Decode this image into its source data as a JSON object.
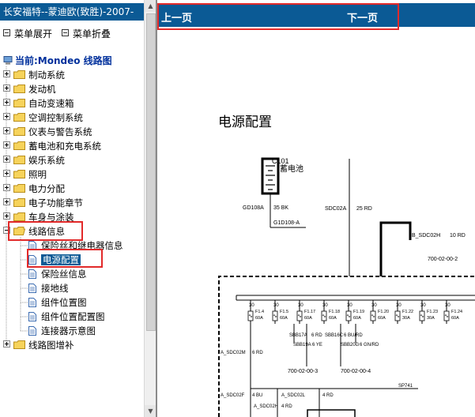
{
  "left_panel": {
    "title": "长安福特--蒙迪欧(致胜)-2007-",
    "expand_label": "菜单展开",
    "collapse_label": "菜单折叠",
    "root_label": "当前:Mondeo 线路图",
    "tree": [
      {
        "label": "制动系统"
      },
      {
        "label": "发动机"
      },
      {
        "label": "自动变速箱"
      },
      {
        "label": "空调控制系统"
      },
      {
        "label": "仪表与警告系统"
      },
      {
        "label": "蓄电池和充电系统"
      },
      {
        "label": "娱乐系统"
      },
      {
        "label": "照明"
      },
      {
        "label": "电力分配"
      },
      {
        "label": "电子功能章节"
      },
      {
        "label": "车身与涂装"
      },
      {
        "label": "线路信息"
      },
      {
        "label": "保险丝和继电器信息"
      },
      {
        "label": "电源配置"
      },
      {
        "label": "保险丝信息"
      },
      {
        "label": "接地线"
      },
      {
        "label": "组件位置图"
      },
      {
        "label": "组件位置配置图"
      },
      {
        "label": "连接器示意图"
      },
      {
        "label": "线路图增补"
      }
    ]
  },
  "right_panel": {
    "prev_label": "上一页",
    "next_label": "下一页",
    "diagram": {
      "title": "电源配置",
      "battery_id": "C101",
      "battery_label": "蓄电池",
      "labels": {
        "gd108a": "GD108A",
        "bk35": "35 BK",
        "g1d108": "G1D108-A",
        "sdc02a": "SDC02A",
        "rd25": "25 RD",
        "b_sdc02h": "B_SDC02H",
        "rd10": "10 RD",
        "ref1": "700-02-00-2",
        "ref2": "700-02-00-3",
        "ref3": "700-02-00-4",
        "ref4": "700-02-00-3",
        "a_sdc02m": "A_SDC02M",
        "rd6a": "6 RD",
        "sbb17a": "SBB17A",
        "rd6b": "6 RD",
        "sbb16c": "SBB16C",
        "bu6": "6 BU/RD",
        "sbb19a": "SBB19A",
        "ye6": "6 YE",
        "sbb20g": "SBB20G",
        "gn6": "6 GN/RD",
        "a_sdc02f": "A_SDC02F",
        "bu4": "4 BU",
        "a_sdc02l": "A_SDC02L",
        "rd4": "4 RD",
        "a_sdc02h": "A_SDC02H",
        "rd4b": "4 RD",
        "sp741": "SP741"
      },
      "fuses": [
        {
          "top": "30",
          "id": "F1.4",
          "amp": "60A"
        },
        {
          "top": "30",
          "id": "F1.5",
          "amp": "60A"
        },
        {
          "top": "30",
          "id": "F1.17",
          "amp": "60A"
        },
        {
          "top": "30",
          "id": "F1.18",
          "amp": "60A"
        },
        {
          "top": "30",
          "id": "F1.19",
          "amp": "60A"
        },
        {
          "top": "30",
          "id": "F1.20",
          "amp": "60A"
        },
        {
          "top": "30",
          "id": "F1.22",
          "amp": "30A"
        },
        {
          "top": "30",
          "id": "F1.23",
          "amp": "30A"
        },
        {
          "top": "30",
          "id": "F1.24",
          "amp": "60A"
        }
      ]
    }
  },
  "colors": {
    "banner": "#0b5a95",
    "highlight": "#e22a2a"
  }
}
